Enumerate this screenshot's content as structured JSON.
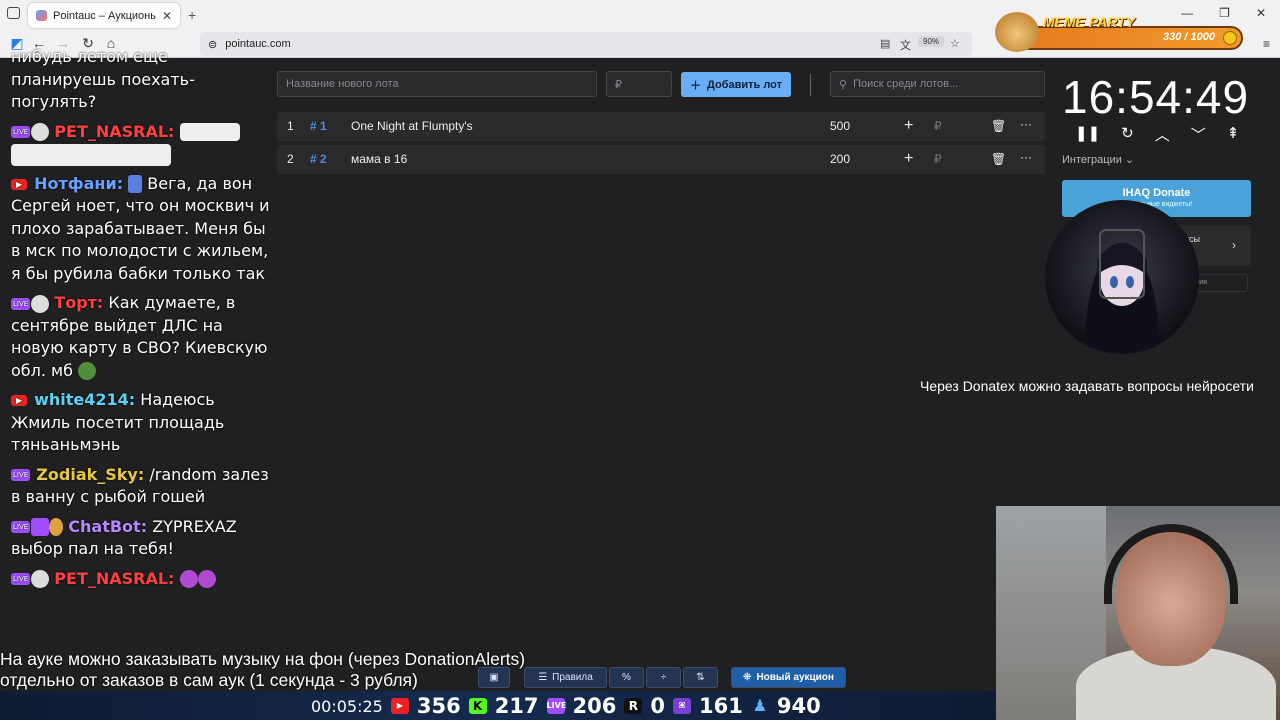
{
  "browser": {
    "tab_title": "Pointauc – Аукционы, лотереи",
    "url": "pointauc.com",
    "zoom": "90%"
  },
  "meme_party": {
    "title": "MEME PARTY",
    "counter": "330 / 1000"
  },
  "lot_form": {
    "name_placeholder": "Название нового лота",
    "amount_placeholder": "₽",
    "add_label": "Добавить лот",
    "search_placeholder": "Поиск среди лотов..."
  },
  "lots": [
    {
      "index": "1",
      "id": "# 1",
      "name": "One Night at Flumpty's",
      "amount": "500",
      "currency": "₽"
    },
    {
      "index": "2",
      "id": "# 2",
      "name": "мама в 16",
      "amount": "200",
      "currency": "₽"
    }
  ],
  "timer": {
    "value": "16:54:49",
    "integrations_label": "Интеграции",
    "donate_title": "IHAQ Donate",
    "donate_sub": "уникальные виджеты!",
    "services_label": "исы",
    "history_label": "тория"
  },
  "caption_right": "Через Donatex можно задавать вопросы нейросети",
  "chat": [
    {
      "platform": "",
      "nick": "",
      "nick_color": "#fff",
      "text": "нибудь летом еще планируешь поехать-погулять?"
    },
    {
      "platform": "live",
      "nick": "PET_NASRAL:",
      "nick_color": "#ff4040",
      "text": ""
    },
    {
      "platform": "yt",
      "nick": "Нотфани:",
      "nick_color": "#6aa0ff",
      "text": "Вега, да вон Сергей ноет, что он москвич и плохо зарабатывает. Меня бы в мск по молодости с жильем, я бы рубила бабки только так"
    },
    {
      "platform": "live",
      "nick": "Торт:",
      "nick_color": "#ff4040",
      "text": "Как думаете, в сентябре выйдет ДЛС на новую карту в СВО? Киевскую обл. мб"
    },
    {
      "platform": "yt",
      "nick": "white4214:",
      "nick_color": "#5fd0f0",
      "text": "Надеюсь Жмиль посетит площадь тяньаньмэнь"
    },
    {
      "platform": "live",
      "nick": "Zodiak_Sky:",
      "nick_color": "#e8c840",
      "text": "/random залез в ванну с рыбой гошей"
    },
    {
      "platform": "live",
      "nick": "ChatBot:",
      "nick_color": "#b488ff",
      "text": "ZYPREXAZ выбор пал на тебя!"
    },
    {
      "platform": "live",
      "nick": "PET_NASRAL:",
      "nick_color": "#ff4040",
      "text": ""
    }
  ],
  "caption_bottom": [
    "На ауке можно заказывать музыку на фон (через DonationAlerts)",
    "отдельно от заказов в сам аук (1 секунда - 3 рубля)"
  ],
  "toolbar": {
    "rules_label": "Правила",
    "new_auction_label": "Новый аукцион"
  },
  "stats": {
    "time": "00:05:25",
    "youtube": "356",
    "kick": "217",
    "vk_live": "206",
    "rutube": "0",
    "trovo": "161",
    "total": "940"
  },
  "colors": {
    "accent": "#69aef5",
    "background": "#202022",
    "lot_id": "#4c8bd6"
  }
}
